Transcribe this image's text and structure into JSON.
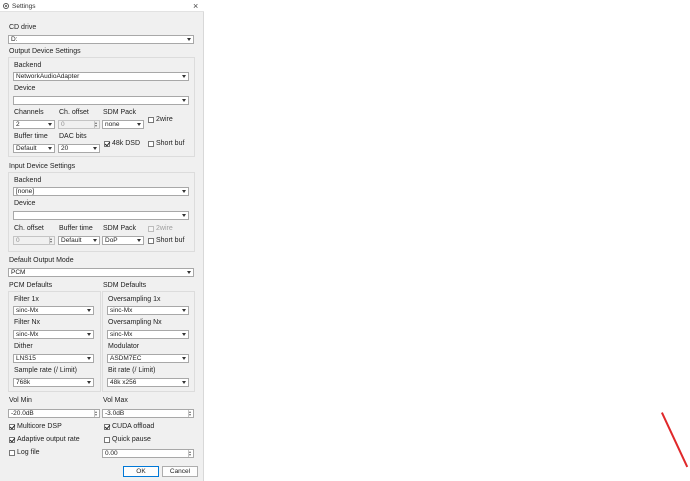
{
  "window": {
    "title": "Settings",
    "close_glyph": "×"
  },
  "cd_drive": {
    "label": "CD drive",
    "value": "D:"
  },
  "output_device": {
    "title": "Output Device Settings",
    "backend_label": "Backend",
    "backend_value": "NetworkAudioAdapter",
    "device_label": "Device",
    "device_value": "",
    "channels_label": "Channels",
    "channels_value": "2",
    "ch_offset_label": "Ch. offset",
    "ch_offset_value": "0",
    "sdm_pack_label": "SDM Pack",
    "sdm_pack_value": "none",
    "two_wire_label": "2wire",
    "buffer_time_label": "Buffer time",
    "buffer_time_value": "Default",
    "dac_bits_label": "DAC bits",
    "dac_bits_value": "20",
    "dsd48_label": "48k DSD",
    "short_buf_label": "Short buf"
  },
  "input_device": {
    "title": "Input Device Settings",
    "backend_label": "Backend",
    "backend_value": "[none]",
    "device_label": "Device",
    "device_value": "",
    "ch_offset_label": "Ch. offset",
    "ch_offset_value": "0",
    "buffer_time_label": "Buffer time",
    "buffer_time_value": "Default",
    "sdm_pack_label": "SDM Pack",
    "sdm_pack_value": "DoP",
    "two_wire_label": "2wire",
    "short_buf_label": "Short buf"
  },
  "default_output_mode": {
    "label": "Default Output Mode",
    "value": "PCM"
  },
  "pcm_defaults": {
    "title": "PCM Defaults",
    "filter1x_label": "Filter 1x",
    "filter1x_value": "sinc-Mx",
    "filternx_label": "Filter Nx",
    "filternx_value": "sinc-Mx",
    "dither_label": "Dither",
    "dither_value": "LNS15",
    "sample_rate_label": "Sample rate (/ Limit)",
    "sample_rate_value": "768k"
  },
  "sdm_defaults": {
    "title": "SDM Defaults",
    "os1x_label": "Oversampling 1x",
    "os1x_value": "sinc-Mx",
    "osnx_label": "Oversampling Nx",
    "osnx_value": "sinc-Mx",
    "modulator_label": "Modulator",
    "modulator_value": "ASDM7EC",
    "bit_rate_label": "Bit rate (/ Limit)",
    "bit_rate_value": "48k x256"
  },
  "vol_min": {
    "label": "Vol Min",
    "value": "-20.0dB"
  },
  "vol_max": {
    "label": "Vol Max",
    "value": "-3.0dB"
  },
  "options": {
    "multicore_dsp": "Multicore DSP",
    "cuda_offload": "CUDA offload",
    "adaptive_rate": "Adaptive output rate",
    "quick_pause": "Quick pause",
    "log_file": "Log file",
    "quick_pause_value": "0.00"
  },
  "buttons": {
    "ok": "OK",
    "cancel": "Cancel"
  },
  "colors": {
    "accent": "#0078d7",
    "annotation_red": "#e0282a"
  }
}
